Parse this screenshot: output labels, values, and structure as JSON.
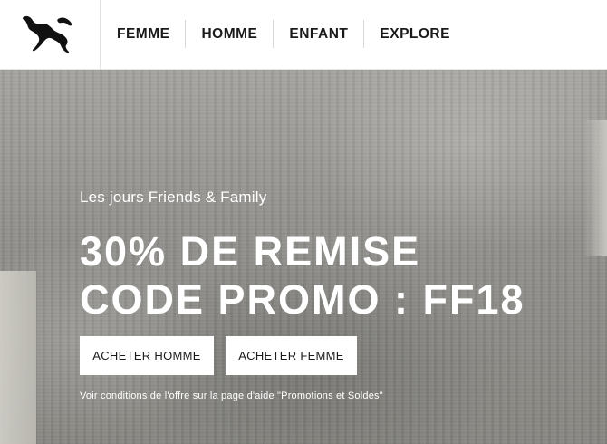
{
  "header": {
    "logo": {
      "icon": "puma-cat-logo-icon"
    },
    "nav": [
      {
        "label": "FEMME"
      },
      {
        "label": "HOMME"
      },
      {
        "label": "ENFANT"
      },
      {
        "label": "EXPLORE"
      }
    ]
  },
  "hero": {
    "subtitle": "Les jours Friends & Family",
    "headline_line1": "30% DE REMISE",
    "headline_line2": "CODE PROMO : FF18",
    "buttons": {
      "shop_men": "ACHETER HOMME",
      "shop_women": "ACHETER FEMME"
    },
    "disclaimer": "Voir conditions de l'offre sur la page d'aide \"Promotions et Soldes\""
  },
  "colors": {
    "text_dark": "#1a1a1a",
    "hero_text": "#ffffff",
    "button_bg": "#ffffff"
  }
}
